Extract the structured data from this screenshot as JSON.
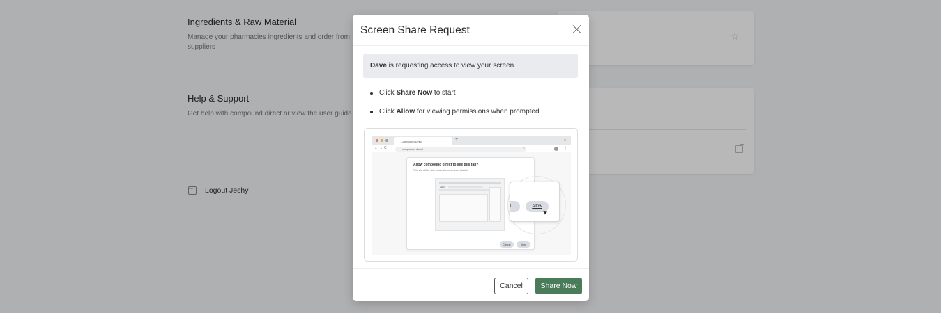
{
  "background": {
    "ingredients": {
      "title": "Ingredients & Raw Material",
      "description": "Manage your pharmacies ingredients and order from suppliers"
    },
    "help": {
      "title": "Help & Support",
      "description": "Get help with compound direct or view the user guide"
    },
    "logout_label": "Logout Jeshy"
  },
  "modal": {
    "title": "Screen Share Request",
    "alert": {
      "requester": "Dave",
      "message": " is requesting access to view your screen."
    },
    "steps": [
      {
        "prefix": "Click ",
        "bold": "Share Now",
        "suffix": " to start"
      },
      {
        "prefix": "Click ",
        "bold": "Allow",
        "suffix": " for viewing permissions when prompted"
      }
    ],
    "illustration": {
      "tab_label": "Compound Direct",
      "url": "compound-direct",
      "dialog_title": "Allow compound direct to see this tab?",
      "dialog_subtitle": "This site will be able to see the contents of this tab.",
      "preview_label": "caFC",
      "cancel_label": "Cancel",
      "allow_label": "Allow",
      "zoom_cancel_label": "ncel",
      "zoom_allow_label": "Allow"
    },
    "footer": {
      "cancel_label": "Cancel",
      "share_label": "Share Now"
    }
  },
  "colors": {
    "primary": "#4a7c59",
    "overlay": "rgba(0,0,0,0.28)",
    "alert_bg": "#e9ebee"
  },
  "icons": {
    "close": "close-icon",
    "star": "star-icon",
    "external": "external-link-icon",
    "logout": "logout-icon",
    "cursor": "cursor-icon"
  }
}
